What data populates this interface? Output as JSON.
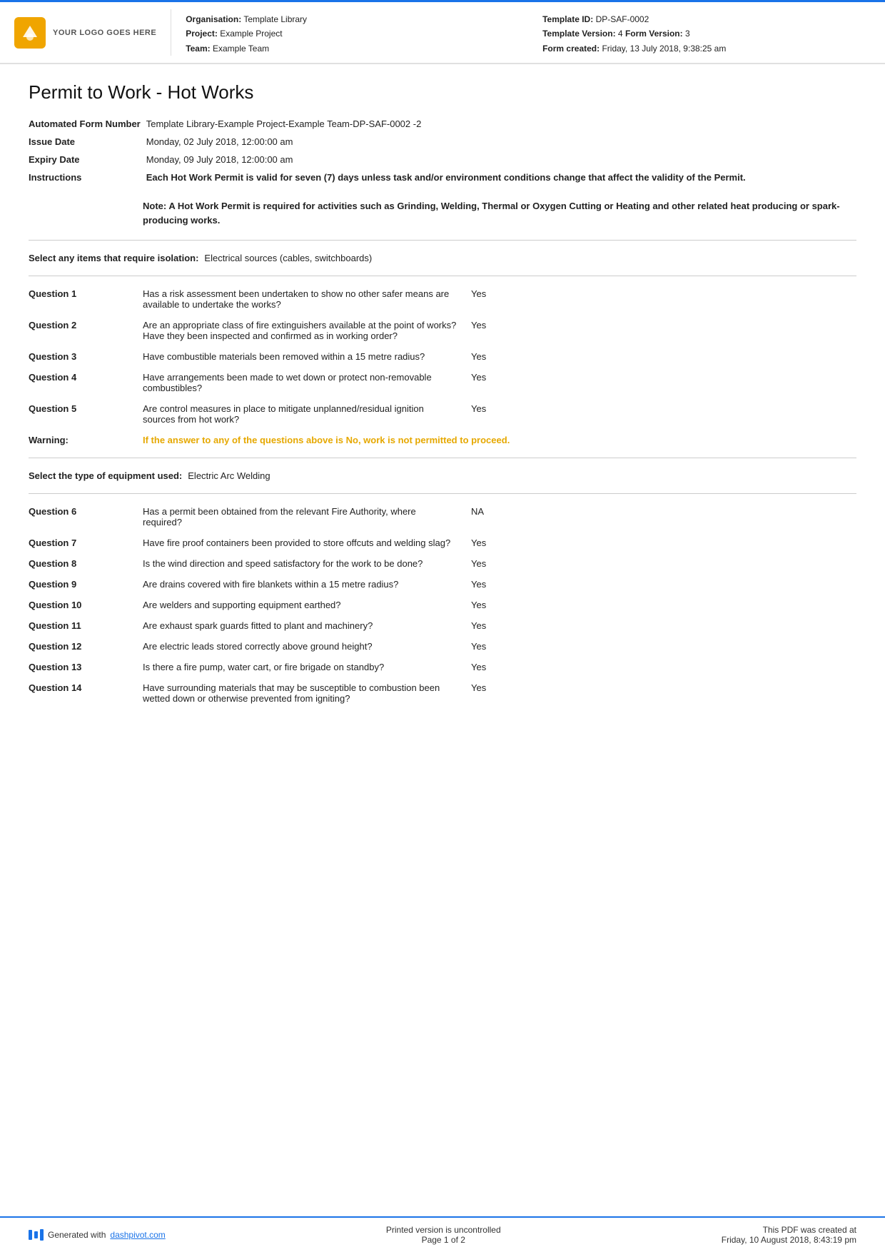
{
  "header": {
    "logo_text": "YOUR LOGO GOES HERE",
    "org_label": "Organisation:",
    "org_value": "Template Library",
    "project_label": "Project:",
    "project_value": "Example Project",
    "team_label": "Team:",
    "team_value": "Example Team",
    "template_id_label": "Template ID:",
    "template_id_value": "DP-SAF-0002",
    "template_version_label": "Template Version:",
    "template_version_value": "4",
    "form_version_label": "Form Version:",
    "form_version_value": "3",
    "form_created_label": "Form created:",
    "form_created_value": "Friday, 13 July 2018, 9:38:25 am"
  },
  "page_title": "Permit to Work - Hot Works",
  "form_number_label": "Automated Form Number",
  "form_number_value": "Template Library-Example Project-Example Team-DP-SAF-0002  -2",
  "issue_date_label": "Issue Date",
  "issue_date_value": "Monday, 02 July 2018, 12:00:00 am",
  "expiry_date_label": "Expiry Date",
  "expiry_date_value": "Monday, 09 July 2018, 12:00:00 am",
  "instructions_label": "Instructions",
  "instructions_value": "Each Hot Work Permit is valid for seven (7) days unless task and/or environment conditions change that affect the validity of the Permit.",
  "note": "Note: A Hot Work Permit is required for activities such as Grinding, Welding, Thermal or Oxygen Cutting or Heating and other related heat producing or spark-producing works.",
  "isolation_label": "Select any items that require isolation:",
  "isolation_value": "Electrical sources (cables, switchboards)",
  "questions": [
    {
      "id": "Question 1",
      "text": "Has a risk assessment been undertaken to show no other safer means are available to undertake the works?",
      "answer": "Yes"
    },
    {
      "id": "Question 2",
      "text": "Are an appropriate class of fire extinguishers available at the point of works? Have they been inspected and confirmed as in working order?",
      "answer": "Yes"
    },
    {
      "id": "Question 3",
      "text": "Have combustible materials been removed within a 15 metre radius?",
      "answer": "Yes"
    },
    {
      "id": "Question 4",
      "text": "Have arrangements been made to wet down or protect non-removable combustibles?",
      "answer": "Yes"
    },
    {
      "id": "Question 5",
      "text": "Are control measures in place to mitigate unplanned/residual ignition sources from hot work?",
      "answer": "Yes"
    }
  ],
  "warning_label": "Warning:",
  "warning_text": "If the answer to any of the questions above is No, work is not permitted to proceed.",
  "equipment_label": "Select the type of equipment used:",
  "equipment_value": "Electric Arc Welding",
  "questions2": [
    {
      "id": "Question 6",
      "text": "Has a permit been obtained from the relevant Fire Authority, where required?",
      "answer": "NA"
    },
    {
      "id": "Question 7",
      "text": "Have fire proof containers been provided to store offcuts and welding slag?",
      "answer": "Yes"
    },
    {
      "id": "Question 8",
      "text": "Is the wind direction and speed satisfactory for the work to be done?",
      "answer": "Yes"
    },
    {
      "id": "Question 9",
      "text": "Are drains covered with fire blankets within a 15 metre radius?",
      "answer": "Yes"
    },
    {
      "id": "Question 10",
      "text": "Are welders and supporting equipment earthed?",
      "answer": "Yes"
    },
    {
      "id": "Question 11",
      "text": "Are exhaust spark guards fitted to plant and machinery?",
      "answer": "Yes"
    },
    {
      "id": "Question 12",
      "text": "Are electric leads stored correctly above ground height?",
      "answer": "Yes"
    },
    {
      "id": "Question 13",
      "text": "Is there a fire pump, water cart, or fire brigade on standby?",
      "answer": "Yes"
    },
    {
      "id": "Question 14",
      "text": "Have surrounding materials that may be susceptible to combustion been wetted down or otherwise prevented from igniting?",
      "answer": "Yes"
    }
  ],
  "footer": {
    "generated_text": "Generated with",
    "dashpivot_link": "dashpivot.com",
    "center_line1": "Printed version is uncontrolled",
    "center_line2": "Page 1 of 2",
    "right_line1": "This PDF was created at",
    "right_line2": "Friday, 10 August 2018, 8:43:19 pm"
  }
}
